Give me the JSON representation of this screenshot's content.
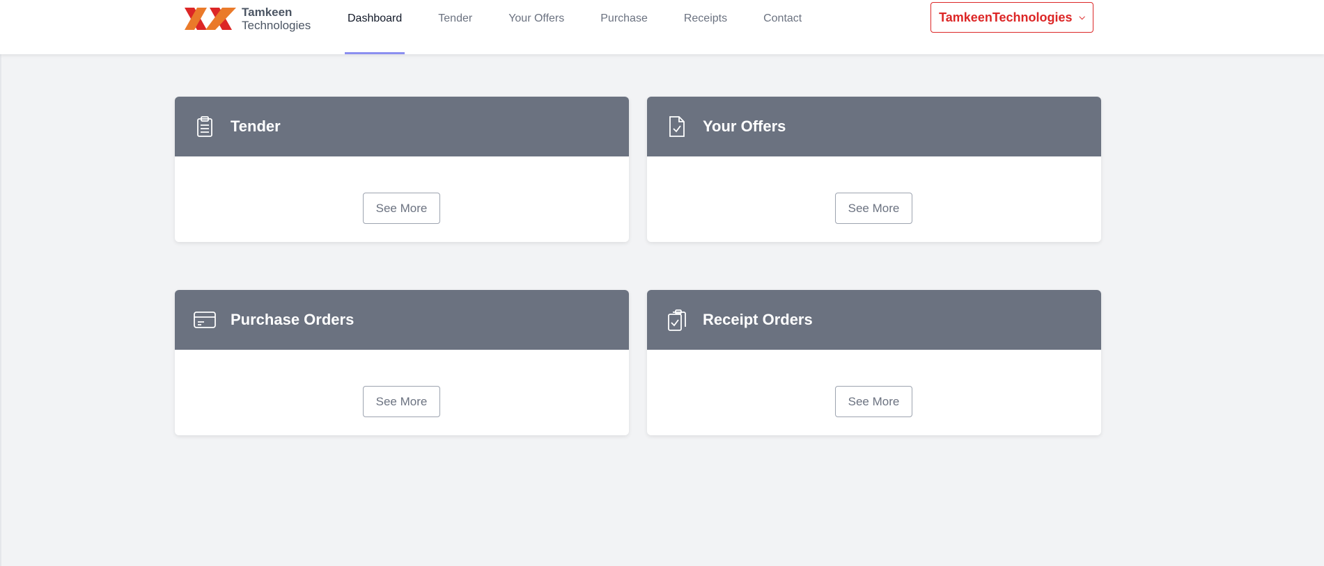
{
  "brand": {
    "line1": "Tamkeen",
    "line2": "Technologies"
  },
  "nav": [
    {
      "label": "Dashboard",
      "active": true
    },
    {
      "label": "Tender"
    },
    {
      "label": "Your Offers"
    },
    {
      "label": "Purchase"
    },
    {
      "label": "Receipts"
    },
    {
      "label": "Contact"
    }
  ],
  "user_menu": {
    "label": "TamkeenTechnologies",
    "icon": "chevron-down-icon"
  },
  "cards": [
    {
      "title": "Tender",
      "icon": "clipboard-list-icon",
      "button": "See More"
    },
    {
      "title": "Your Offers",
      "icon": "file-check-icon",
      "button": "See More"
    },
    {
      "title": "Purchase Orders",
      "icon": "credit-card-icon",
      "button": "See More"
    },
    {
      "title": "Receipt Orders",
      "icon": "clipboard-check-icon",
      "button": "See More"
    }
  ],
  "colors": {
    "accent": "#dc2626",
    "card_header": "#6b7280",
    "active_underline": "#8b8ff0",
    "background": "#f2f3f5"
  }
}
